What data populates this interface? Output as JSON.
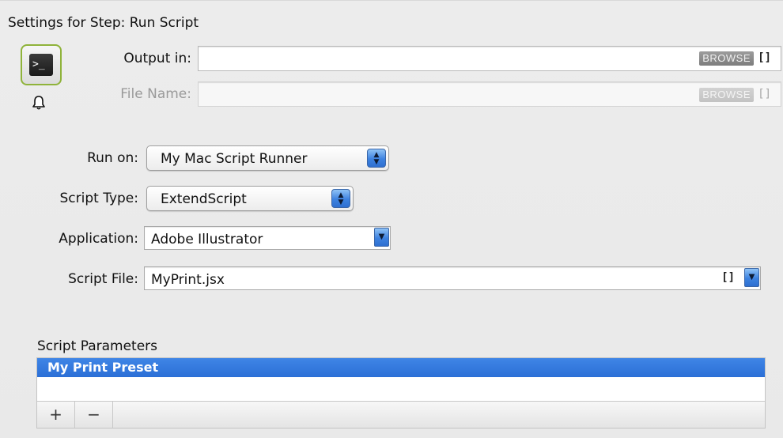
{
  "panel": {
    "title": "Settings for Step: Run Script"
  },
  "icons": {
    "step": "terminal-icon",
    "notify": "bell-icon"
  },
  "terminal_glyph": ">_",
  "output": {
    "label": "Output in:",
    "value": "",
    "browse_label": "BROWSE",
    "brackets": "[]"
  },
  "filename": {
    "label": "File Name:",
    "value": "",
    "browse_label": "BROWSE",
    "brackets": "[]"
  },
  "run_on": {
    "label": "Run on:",
    "value": "My Mac Script Runner"
  },
  "script_type": {
    "label": "Script Type:",
    "value": "ExtendScript"
  },
  "application": {
    "label": "Application:",
    "value": "Adobe Illustrator"
  },
  "script_file": {
    "label": "Script File:",
    "value": "MyPrint.jsx",
    "brackets": "[]"
  },
  "params": {
    "label": "Script Parameters",
    "items": [
      "My Print Preset"
    ],
    "add_label": "+",
    "remove_label": "−"
  },
  "colors": {
    "accent_blue": "#2b6fd6",
    "icon_border_green": "#8fb33a"
  }
}
